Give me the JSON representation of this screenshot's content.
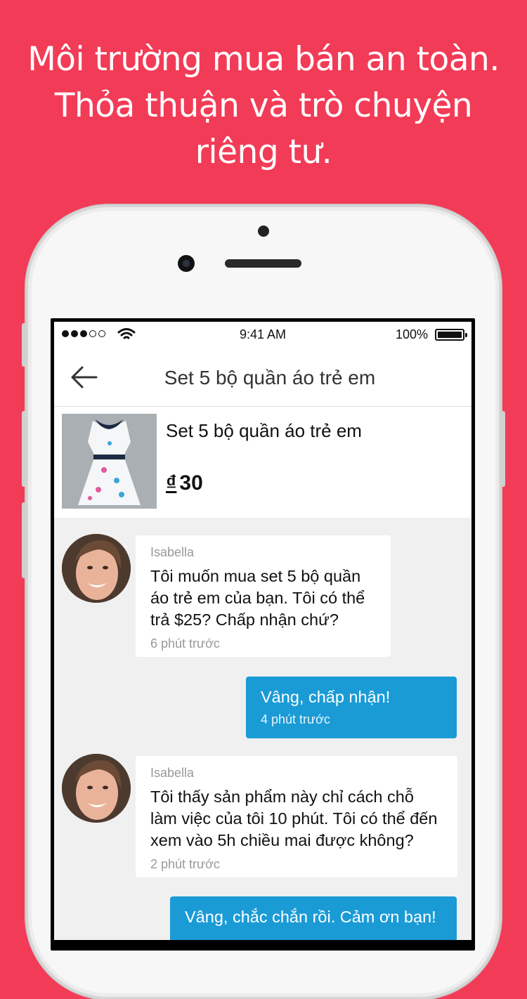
{
  "headline": {
    "line1": "Môi trường mua bán an toàn.",
    "line2": "Thỏa thuận và trò chuyện",
    "line3": "riêng tư."
  },
  "statusbar": {
    "time": "9:41 AM",
    "battery": "100%"
  },
  "nav": {
    "title": "Set 5 bộ quần áo trẻ em"
  },
  "product": {
    "name": "Set 5 bộ quần áo trẻ em",
    "currency": "₫",
    "price": "30"
  },
  "messages": [
    {
      "sender": "Isabella",
      "text": "Tôi muốn mua set 5 bộ quần áo trẻ em của bạn. Tôi có thể trả $25? Chấp nhận chứ?",
      "time": "6 phút trước"
    },
    {
      "text": "Vâng, chấp nhận!",
      "time": "4 phút trước"
    },
    {
      "sender": "Isabella",
      "text": "Tôi thấy sản phẩm này chỉ cách chỗ làm việc của tôi 10 phút. Tôi có thể đến xem vào 5h chiều mai được không?",
      "time": "2 phút trước"
    },
    {
      "text": "Vâng, chắc chắn rồi. Cảm ơn bạn!",
      "time": ""
    }
  ],
  "colors": {
    "background": "#f23b57",
    "outgoing_bubble": "#1a9bd6",
    "incoming_bubble": "#ffffff"
  }
}
